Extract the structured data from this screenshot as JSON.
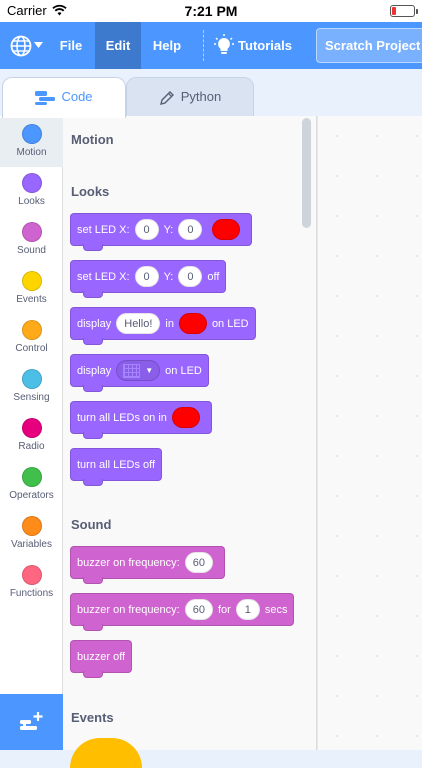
{
  "status": {
    "carrier": "Carrier",
    "time": "7:21 PM"
  },
  "menu": {
    "file": "File",
    "edit": "Edit",
    "help": "Help",
    "tutorials": "Tutorials",
    "project": "Scratch Project"
  },
  "tabs": {
    "code": "Code",
    "python": "Python"
  },
  "categories": [
    {
      "label": "Motion",
      "color": "#4c97ff"
    },
    {
      "label": "Looks",
      "color": "#9966ff"
    },
    {
      "label": "Sound",
      "color": "#cf63cf"
    },
    {
      "label": "Events",
      "color": "#ffd500"
    },
    {
      "label": "Control",
      "color": "#ffab19"
    },
    {
      "label": "Sensing",
      "color": "#4cbfe6"
    },
    {
      "label": "Radio",
      "color": "#e6007e"
    },
    {
      "label": "Operators",
      "color": "#40bf4a"
    },
    {
      "label": "Variables",
      "color": "#ff8c1a"
    },
    {
      "label": "Functions",
      "color": "#ff6680"
    }
  ],
  "palette": {
    "motion_heading": "Motion",
    "looks_heading": "Looks",
    "sound_heading": "Sound",
    "events_heading": "Events",
    "b1": {
      "a": "set LED X:",
      "x": "0",
      "b": "Y:",
      "y": "0"
    },
    "b2": {
      "a": "set LED X:",
      "x": "0",
      "b": "Y:",
      "y": "0",
      "c": "off"
    },
    "b3": {
      "a": "display",
      "text": "Hello!",
      "b": "in",
      "c": "on LED"
    },
    "b4": {
      "a": "display",
      "c": "on LED"
    },
    "b5": {
      "a": "turn all LEDs on in"
    },
    "b6": {
      "a": "turn all LEDs off"
    },
    "b7": {
      "a": "buzzer on frequency:",
      "v": "60"
    },
    "b8": {
      "a": "buzzer on frequency:",
      "v": "60",
      "b": "for",
      "n": "1",
      "c": "secs"
    },
    "b9": {
      "a": "buzzer off"
    }
  },
  "colors": {
    "menu": "#4c97ff",
    "looks": "#9966ff",
    "sound": "#cf63cf",
    "led_red": "#ff0000",
    "events": "#ffbf00"
  }
}
